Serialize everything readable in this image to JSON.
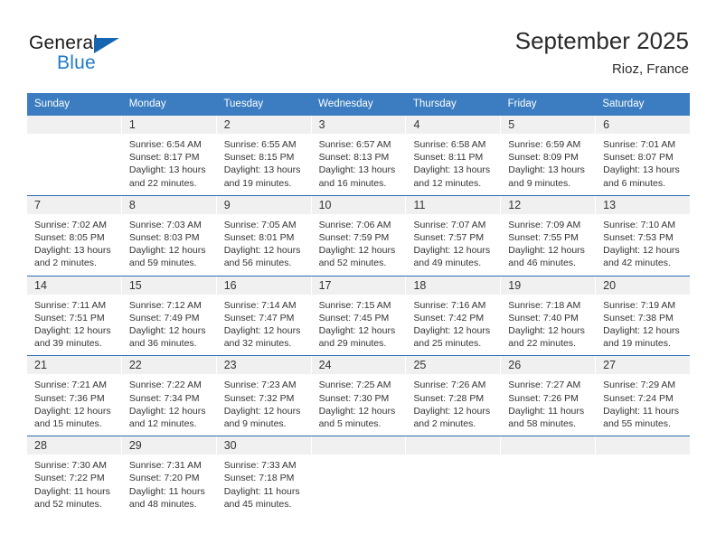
{
  "brand": {
    "name_part1": "General",
    "name_part2": "Blue",
    "accent_color": "#1f7ac4",
    "triangle_color": "#1565b0"
  },
  "header": {
    "title": "September 2025",
    "location": "Rioz, France"
  },
  "theme": {
    "header_bg": "#3b7dc0",
    "header_text": "#ffffff",
    "daynum_bg": "#f0f0f0",
    "week_divider": "#2a6bb0",
    "body_text": "#333333"
  },
  "weekdays": [
    "Sunday",
    "Monday",
    "Tuesday",
    "Wednesday",
    "Thursday",
    "Friday",
    "Saturday"
  ],
  "labels": {
    "sunrise_prefix": "Sunrise:",
    "sunset_prefix": "Sunset:",
    "daylight_prefix": "Daylight:"
  },
  "weeks": [
    [
      {
        "day": "",
        "sunrise": "",
        "sunset": "",
        "daylight": ""
      },
      {
        "day": "1",
        "sunrise": "Sunrise: 6:54 AM",
        "sunset": "Sunset: 8:17 PM",
        "daylight": "Daylight: 13 hours and 22 minutes."
      },
      {
        "day": "2",
        "sunrise": "Sunrise: 6:55 AM",
        "sunset": "Sunset: 8:15 PM",
        "daylight": "Daylight: 13 hours and 19 minutes."
      },
      {
        "day": "3",
        "sunrise": "Sunrise: 6:57 AM",
        "sunset": "Sunset: 8:13 PM",
        "daylight": "Daylight: 13 hours and 16 minutes."
      },
      {
        "day": "4",
        "sunrise": "Sunrise: 6:58 AM",
        "sunset": "Sunset: 8:11 PM",
        "daylight": "Daylight: 13 hours and 12 minutes."
      },
      {
        "day": "5",
        "sunrise": "Sunrise: 6:59 AM",
        "sunset": "Sunset: 8:09 PM",
        "daylight": "Daylight: 13 hours and 9 minutes."
      },
      {
        "day": "6",
        "sunrise": "Sunrise: 7:01 AM",
        "sunset": "Sunset: 8:07 PM",
        "daylight": "Daylight: 13 hours and 6 minutes."
      }
    ],
    [
      {
        "day": "7",
        "sunrise": "Sunrise: 7:02 AM",
        "sunset": "Sunset: 8:05 PM",
        "daylight": "Daylight: 13 hours and 2 minutes."
      },
      {
        "day": "8",
        "sunrise": "Sunrise: 7:03 AM",
        "sunset": "Sunset: 8:03 PM",
        "daylight": "Daylight: 12 hours and 59 minutes."
      },
      {
        "day": "9",
        "sunrise": "Sunrise: 7:05 AM",
        "sunset": "Sunset: 8:01 PM",
        "daylight": "Daylight: 12 hours and 56 minutes."
      },
      {
        "day": "10",
        "sunrise": "Sunrise: 7:06 AM",
        "sunset": "Sunset: 7:59 PM",
        "daylight": "Daylight: 12 hours and 52 minutes."
      },
      {
        "day": "11",
        "sunrise": "Sunrise: 7:07 AM",
        "sunset": "Sunset: 7:57 PM",
        "daylight": "Daylight: 12 hours and 49 minutes."
      },
      {
        "day": "12",
        "sunrise": "Sunrise: 7:09 AM",
        "sunset": "Sunset: 7:55 PM",
        "daylight": "Daylight: 12 hours and 46 minutes."
      },
      {
        "day": "13",
        "sunrise": "Sunrise: 7:10 AM",
        "sunset": "Sunset: 7:53 PM",
        "daylight": "Daylight: 12 hours and 42 minutes."
      }
    ],
    [
      {
        "day": "14",
        "sunrise": "Sunrise: 7:11 AM",
        "sunset": "Sunset: 7:51 PM",
        "daylight": "Daylight: 12 hours and 39 minutes."
      },
      {
        "day": "15",
        "sunrise": "Sunrise: 7:12 AM",
        "sunset": "Sunset: 7:49 PM",
        "daylight": "Daylight: 12 hours and 36 minutes."
      },
      {
        "day": "16",
        "sunrise": "Sunrise: 7:14 AM",
        "sunset": "Sunset: 7:47 PM",
        "daylight": "Daylight: 12 hours and 32 minutes."
      },
      {
        "day": "17",
        "sunrise": "Sunrise: 7:15 AM",
        "sunset": "Sunset: 7:45 PM",
        "daylight": "Daylight: 12 hours and 29 minutes."
      },
      {
        "day": "18",
        "sunrise": "Sunrise: 7:16 AM",
        "sunset": "Sunset: 7:42 PM",
        "daylight": "Daylight: 12 hours and 25 minutes."
      },
      {
        "day": "19",
        "sunrise": "Sunrise: 7:18 AM",
        "sunset": "Sunset: 7:40 PM",
        "daylight": "Daylight: 12 hours and 22 minutes."
      },
      {
        "day": "20",
        "sunrise": "Sunrise: 7:19 AM",
        "sunset": "Sunset: 7:38 PM",
        "daylight": "Daylight: 12 hours and 19 minutes."
      }
    ],
    [
      {
        "day": "21",
        "sunrise": "Sunrise: 7:21 AM",
        "sunset": "Sunset: 7:36 PM",
        "daylight": "Daylight: 12 hours and 15 minutes."
      },
      {
        "day": "22",
        "sunrise": "Sunrise: 7:22 AM",
        "sunset": "Sunset: 7:34 PM",
        "daylight": "Daylight: 12 hours and 12 minutes."
      },
      {
        "day": "23",
        "sunrise": "Sunrise: 7:23 AM",
        "sunset": "Sunset: 7:32 PM",
        "daylight": "Daylight: 12 hours and 9 minutes."
      },
      {
        "day": "24",
        "sunrise": "Sunrise: 7:25 AM",
        "sunset": "Sunset: 7:30 PM",
        "daylight": "Daylight: 12 hours and 5 minutes."
      },
      {
        "day": "25",
        "sunrise": "Sunrise: 7:26 AM",
        "sunset": "Sunset: 7:28 PM",
        "daylight": "Daylight: 12 hours and 2 minutes."
      },
      {
        "day": "26",
        "sunrise": "Sunrise: 7:27 AM",
        "sunset": "Sunset: 7:26 PM",
        "daylight": "Daylight: 11 hours and 58 minutes."
      },
      {
        "day": "27",
        "sunrise": "Sunrise: 7:29 AM",
        "sunset": "Sunset: 7:24 PM",
        "daylight": "Daylight: 11 hours and 55 minutes."
      }
    ],
    [
      {
        "day": "28",
        "sunrise": "Sunrise: 7:30 AM",
        "sunset": "Sunset: 7:22 PM",
        "daylight": "Daylight: 11 hours and 52 minutes."
      },
      {
        "day": "29",
        "sunrise": "Sunrise: 7:31 AM",
        "sunset": "Sunset: 7:20 PM",
        "daylight": "Daylight: 11 hours and 48 minutes."
      },
      {
        "day": "30",
        "sunrise": "Sunrise: 7:33 AM",
        "sunset": "Sunset: 7:18 PM",
        "daylight": "Daylight: 11 hours and 45 minutes."
      },
      {
        "day": "",
        "sunrise": "",
        "sunset": "",
        "daylight": ""
      },
      {
        "day": "",
        "sunrise": "",
        "sunset": "",
        "daylight": ""
      },
      {
        "day": "",
        "sunrise": "",
        "sunset": "",
        "daylight": ""
      },
      {
        "day": "",
        "sunrise": "",
        "sunset": "",
        "daylight": ""
      }
    ]
  ]
}
